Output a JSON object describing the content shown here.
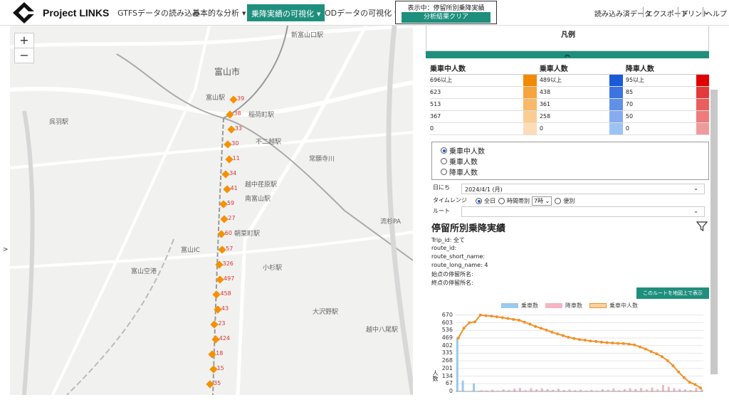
{
  "header": {
    "app_title": "Project LINKS",
    "nav": [
      {
        "label": "GTFSデータの読み込み"
      },
      {
        "label": "基本的な分析"
      },
      {
        "label": "乗降実績の可視化"
      },
      {
        "label": "ODデータの可視化"
      }
    ],
    "status_label": "表示中：停留所別乗降実績",
    "clear_button": "分析結果クリア",
    "right_links": [
      "読み込み済データ",
      "エクスポート",
      "プリント",
      "ヘルプ"
    ]
  },
  "map": {
    "zoom_in": "+",
    "zoom_out": "−",
    "collapse": ">",
    "city": "富山市",
    "places": [
      {
        "text": "富山駅"
      },
      {
        "text": "稲荷町駅"
      },
      {
        "text": "不二越駅"
      },
      {
        "text": "越中荏原駅"
      },
      {
        "text": "南富山駅"
      },
      {
        "text": "朝菜町駅"
      },
      {
        "text": "小杉駅"
      },
      {
        "text": "富山IC"
      },
      {
        "text": "富山空港"
      },
      {
        "text": "越中八尾駅"
      },
      {
        "text": "新富山口駅"
      },
      {
        "text": "呉羽駅"
      },
      {
        "text": "常願寺川"
      },
      {
        "text": "流杉PA"
      },
      {
        "text": "大沢野駅"
      }
    ],
    "stop_labels": [
      "39",
      "38",
      "33",
      "30",
      "11",
      "34",
      "41",
      "59",
      "27",
      "60",
      "57",
      "326",
      "497",
      "458",
      "43",
      "23",
      "424",
      "18",
      "15",
      "35"
    ]
  },
  "legend": {
    "title": "凡例",
    "toggle": "︽",
    "columns": [
      "乗車中人数",
      "乗車人数",
      "降車人数"
    ],
    "rows": [
      {
        "on_board": "696以上",
        "board": "489以上",
        "alight": "95以上"
      },
      {
        "on_board": "623",
        "board": "438",
        "alight": "85"
      },
      {
        "on_board": "513",
        "board": "361",
        "alight": "70"
      },
      {
        "on_board": "367",
        "board": "258",
        "alight": "50"
      },
      {
        "on_board": "0",
        "board": "0",
        "alight": "0"
      }
    ],
    "colors": {
      "on_board": [
        "#f28a00",
        "#f6a43d",
        "#f9b968",
        "#fbcd92",
        "#fddcb6"
      ],
      "board": [
        "#1a5ad6",
        "#3c73e0",
        "#6190e8",
        "#86acef",
        "#9cc4f3"
      ],
      "alight": [
        "#e00000",
        "#e53a3a",
        "#ea5e5e",
        "#ee7b7b",
        "#f09b9b"
      ]
    }
  },
  "options": {
    "display_mode": [
      "乗車中人数",
      "乗車人数",
      "降車人数"
    ],
    "date_label": "日にち",
    "date_value": "2024/4/1 (月)",
    "timerange_label": "タイムレンジ",
    "timerange_opts": [
      "全日",
      "時間帯別",
      "便別"
    ],
    "hour_value": "7時",
    "route_label": "ルート",
    "route_value": ""
  },
  "summary": {
    "title": "停留所別乗降実績",
    "trip_id": "Trip_id: 全て",
    "route_id": "route_id:",
    "route_short_name": "route_short_name:",
    "route_long_name": "route_long_name: 4",
    "start_stop": "始点の停留所名:",
    "end_stop": "終点の停留所名:",
    "show_route_button": "このルートを地図上で表示"
  },
  "chart_data": {
    "type": "bar",
    "legend": [
      "乗車数",
      "降車数",
      "乗車中人数"
    ],
    "ylabel": "人数",
    "yticks": [
      0,
      67,
      134,
      201,
      268,
      335,
      402,
      469,
      536,
      603,
      670
    ],
    "ylim": [
      0,
      700
    ],
    "series": [
      {
        "name": "乗車数",
        "values": [
          469,
          95,
          0,
          70,
          5,
          4,
          3,
          3,
          2,
          2,
          1,
          2,
          1,
          1,
          1,
          1,
          1,
          0,
          0,
          0,
          0,
          0,
          0,
          0,
          0,
          0,
          0,
          0,
          0,
          0,
          0,
          0,
          0,
          0,
          0,
          0,
          0,
          0,
          0,
          0,
          0,
          0,
          0,
          0,
          0
        ]
      },
      {
        "name": "降車数",
        "values": [
          0,
          0,
          0,
          0,
          10,
          8,
          15,
          6,
          18,
          12,
          25,
          30,
          10,
          28,
          18,
          26,
          20,
          14,
          24,
          12,
          16,
          10,
          14,
          8,
          12,
          6,
          20,
          14,
          26,
          10,
          20,
          28,
          22,
          30,
          16,
          34,
          18,
          56,
          40,
          28,
          22,
          18,
          12,
          30,
          20
        ]
      },
      {
        "name": "乗車中人数",
        "values": [
          469,
          555,
          603,
          610,
          670,
          665,
          662,
          655,
          648,
          640,
          632,
          625,
          608,
          590,
          570,
          555,
          538,
          520,
          505,
          490,
          475,
          465,
          455,
          450,
          442,
          438,
          432,
          428,
          425,
          422,
          420,
          415,
          408,
          390,
          372,
          350,
          330,
          305,
          270,
          225,
          170,
          120,
          80,
          60,
          30
        ]
      }
    ]
  }
}
